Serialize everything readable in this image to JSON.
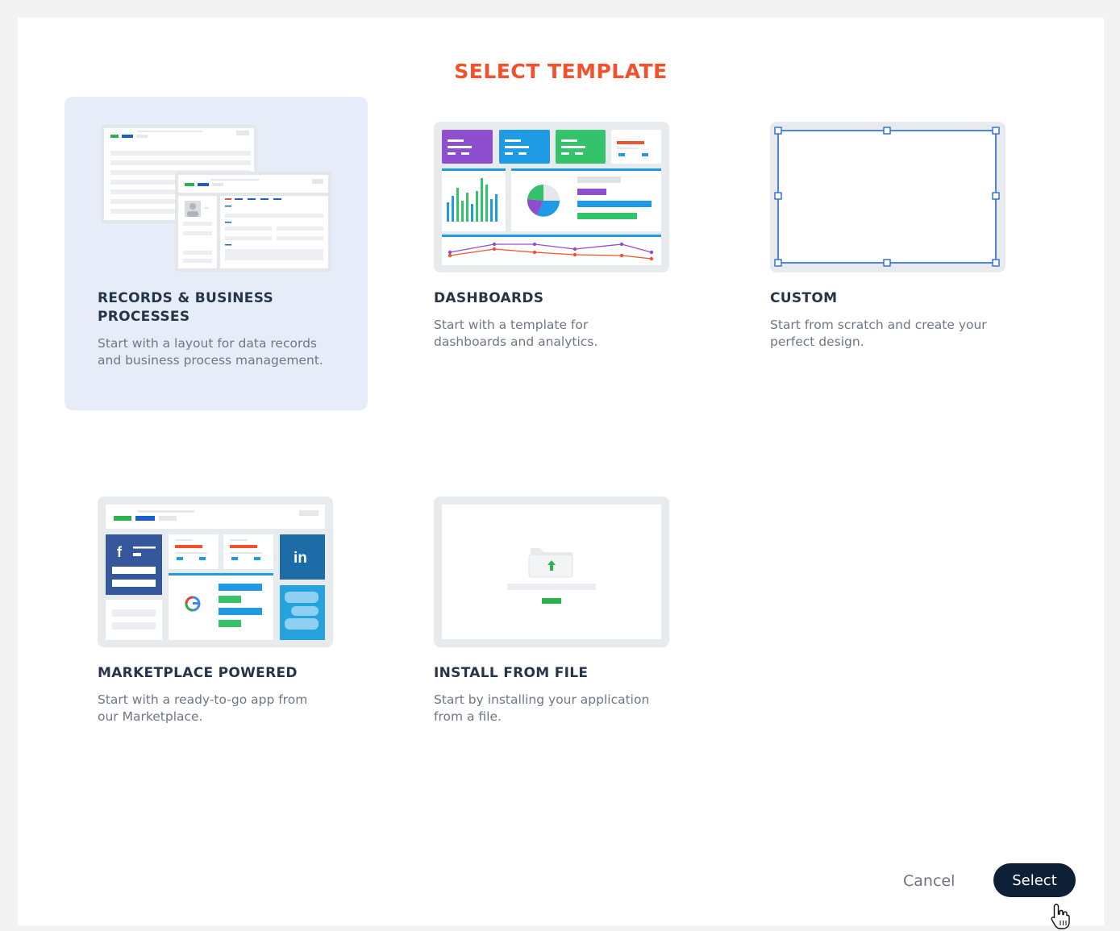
{
  "dialog": {
    "title": "SELECT TEMPLATE"
  },
  "templates": [
    {
      "id": "records",
      "title": "RECORDS & BUSINESS PROCESSES",
      "description": "Start with a layout for data records and business process management.",
      "selected": true
    },
    {
      "id": "dashboards",
      "title": "DASHBOARDS",
      "description": "Start with a template for dashboards and analytics.",
      "selected": false
    },
    {
      "id": "custom",
      "title": "CUSTOM",
      "description": "Start from scratch and create your perfect design.",
      "selected": false
    },
    {
      "id": "marketplace",
      "title": "MARKETPLACE POWERED",
      "description": "Start with a ready-to-go app from our Marketplace.",
      "selected": false
    },
    {
      "id": "install",
      "title": "INSTALL FROM FILE",
      "description": "Start by installing your application from a file.",
      "selected": false
    }
  ],
  "thumb_icons": {
    "marketplace_linkedin": "in",
    "marketplace_facebook": "f"
  },
  "footer": {
    "cancel_label": "Cancel",
    "select_label": "Select"
  },
  "colors": {
    "accent_title": "#f2512b",
    "selected_card_bg": "#e7edf8",
    "primary_button": "#0e2035",
    "green": "#34c36a",
    "blue": "#1e9be4",
    "purple": "#8e4fcf",
    "red": "#f2512b",
    "custom_frame": "#1c5fd8"
  }
}
